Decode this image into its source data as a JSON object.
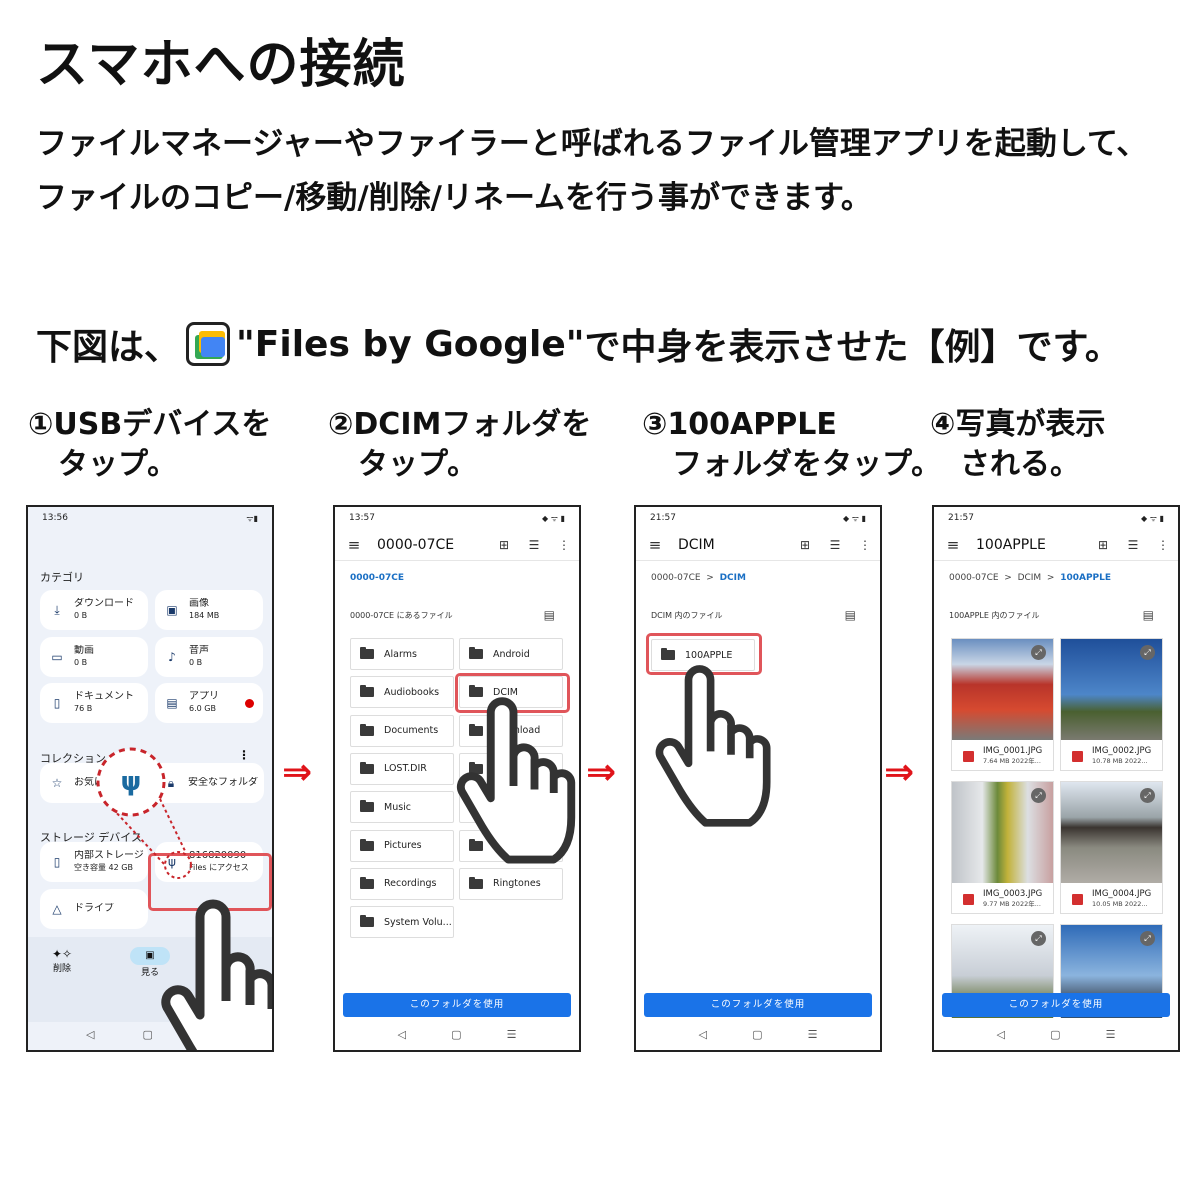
{
  "title": "スマホへの接続",
  "description": [
    "ファイルマネージャーやファイラーと呼ばれるファイル管理アプリを起動して、",
    "ファイルのコピー/移動/削除/リネームを行う事ができます。"
  ],
  "intro": {
    "prefix": "下図は、",
    "app_icon": "files-by-google-icon",
    "app_name": "\"Files by Google\"",
    "suffix": "で中身を表示させた【例】です。"
  },
  "steps": [
    "①USBデバイスを\n　タップ。",
    "②DCIMフォルダを\n　タップ。",
    "③100APPLE\n　フォルダをタップ。",
    "④写真が表示\n　される。"
  ],
  "arrow": "⇒",
  "accent_color": "#e0141a",
  "phone1": {
    "time": "13:56",
    "status": "ᯤ▮",
    "category_label": "カテゴリ",
    "categories": [
      {
        "icon": "download-icon",
        "name": "ダウンロード",
        "size": "0 B"
      },
      {
        "icon": "image-icon",
        "name": "画像",
        "size": "184 MB"
      },
      {
        "icon": "video-icon",
        "name": "動画",
        "size": "0 B"
      },
      {
        "icon": "music-note-icon",
        "name": "音声",
        "size": "0 B"
      },
      {
        "icon": "document-icon",
        "name": "ドキュメント",
        "size": "76 B"
      },
      {
        "icon": "android-icon",
        "name": "アプリ",
        "size": "6.0 GB"
      }
    ],
    "collection_label": "コレクション",
    "collections": [
      {
        "icon": "star-icon",
        "name": "お気に入り"
      },
      {
        "icon": "lock-icon",
        "name": "安全なフォルダ"
      }
    ],
    "storage_label": "ストレージ デバイス",
    "storage": [
      {
        "icon": "phone-icon",
        "name": "内部ストレージ",
        "detail": "空き容量 42 GB"
      },
      {
        "icon": "usb-icon",
        "name": "816820090",
        "detail": "Files にアクセス"
      },
      {
        "icon": "drive-icon",
        "name": "ドライブ",
        "detail": ""
      }
    ],
    "bottom_nav": [
      {
        "icon": "sparkle-icon",
        "label": "削除"
      },
      {
        "icon": "browse-icon",
        "label": "見る"
      }
    ]
  },
  "phone2": {
    "time": "13:57",
    "title": "0000-07CE",
    "breadcrumb": [
      "0000-07CE"
    ],
    "files_header": "0000-07CE にあるファイル",
    "folders": [
      "Alarms",
      "Android",
      "Audiobooks",
      "DCIM",
      "Documents",
      "Download",
      "LOST.DIR",
      "",
      "Music",
      "",
      "Pictures",
      "",
      "Recordings",
      "Ringtones",
      "System Volu..."
    ],
    "button": "このフォルダを使用"
  },
  "phone3": {
    "time": "21:57",
    "title": "DCIM",
    "breadcrumb": [
      "0000-07CE",
      "DCIM"
    ],
    "files_header": "DCIM 内のファイル",
    "folders": [
      "100APPLE"
    ],
    "button": "このフォルダを使用"
  },
  "phone4": {
    "time": "21:57",
    "title": "100APPLE",
    "breadcrumb": [
      "0000-07CE",
      "DCIM",
      "100APPLE"
    ],
    "files_header": "100APPLE 内のファイル",
    "photos": [
      {
        "name": "IMG_0001.JPG",
        "meta": "7.64 MB 2022年..."
      },
      {
        "name": "IMG_0002.JPG",
        "meta": "10.78 MB 2022..."
      },
      {
        "name": "IMG_0003.JPG",
        "meta": "9.77 MB 2022年..."
      },
      {
        "name": "IMG_0004.JPG",
        "meta": "10.05 MB 2022..."
      },
      {
        "name": "",
        "meta": ""
      },
      {
        "name": "",
        "meta": ""
      }
    ],
    "button": "このフォルダを使用"
  },
  "nav_buttons": [
    "◁",
    "▢",
    "☰"
  ]
}
